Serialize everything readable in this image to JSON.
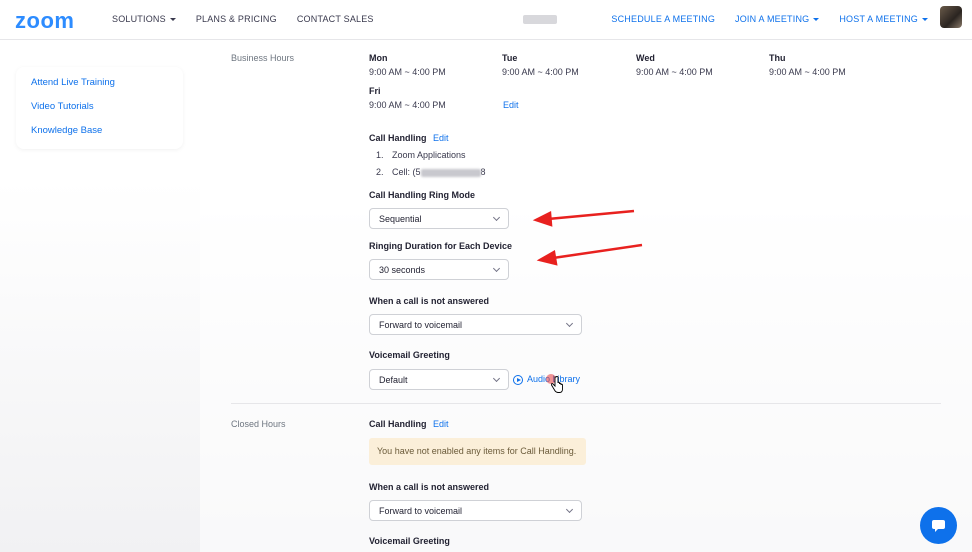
{
  "nav": {
    "logo": "zoom",
    "left_items": [
      "SOLUTIONS",
      "PLANS & PRICING",
      "CONTACT SALES"
    ],
    "right_items": [
      "SCHEDULE A MEETING",
      "JOIN A MEETING",
      "HOST A MEETING"
    ]
  },
  "sidebar": {
    "links": [
      "Attend Live Training",
      "Video Tutorials",
      "Knowledge Base"
    ]
  },
  "business_hours": {
    "label": "Business Hours",
    "days": [
      {
        "day": "Mon",
        "hours": "9:00 AM ~ 4:00 PM"
      },
      {
        "day": "Tue",
        "hours": "9:00 AM ~ 4:00 PM"
      },
      {
        "day": "Wed",
        "hours": "9:00 AM ~ 4:00 PM"
      },
      {
        "day": "Thu",
        "hours": "9:00 AM ~ 4:00 PM"
      },
      {
        "day": "Fri",
        "hours": "9:00 AM ~ 4:00 PM"
      }
    ],
    "edit_label": "Edit",
    "call_handling": {
      "title": "Call Handling",
      "edit_label": "Edit",
      "items": [
        "1.",
        "Zoom Applications",
        "2.",
        "Cell: (5",
        "8"
      ]
    },
    "ring_mode": {
      "label": "Call Handling Ring Mode",
      "value": "Sequential"
    },
    "ring_duration": {
      "label": "Ringing Duration for Each Device",
      "value": "30 seconds"
    },
    "not_answered": {
      "label": "When a call is not answered",
      "value": "Forward to voicemail"
    },
    "voicemail": {
      "label": "Voicemail Greeting",
      "value": "Default",
      "audio_library": "Audio Library"
    }
  },
  "closed_hours": {
    "label": "Closed Hours",
    "call_handling": {
      "title": "Call Handling",
      "edit_label": "Edit"
    },
    "notice": "You have not enabled any items for Call Handling.",
    "not_answered": {
      "label": "When a call is not answered",
      "value": "Forward to voicemail"
    },
    "voicemail": {
      "label": "Voicemail Greeting"
    }
  },
  "colors": {
    "brand": "#2d8cff",
    "link": "#0e71eb",
    "annotation": "#e8211f"
  }
}
